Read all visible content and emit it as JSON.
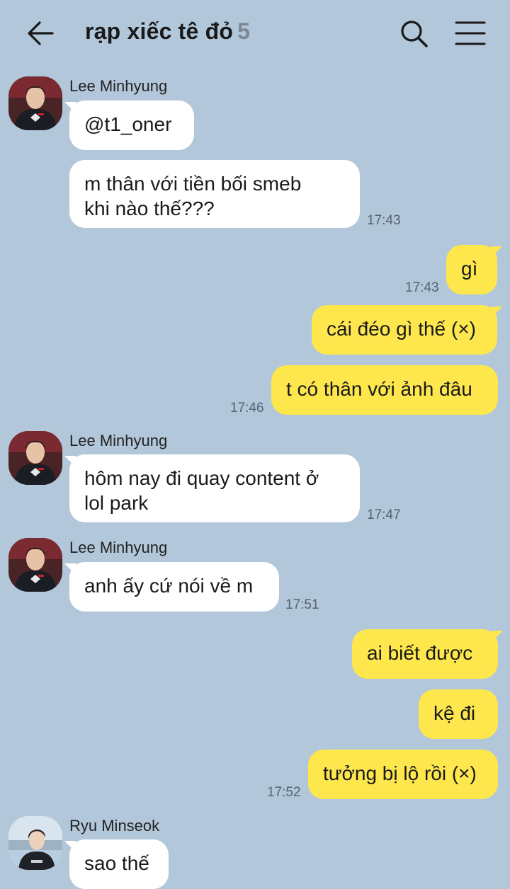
{
  "header": {
    "title": "rạp xiếc tê đỏ",
    "member_count": "5",
    "back_icon": "arrow-left-icon",
    "search_icon": "search-icon",
    "menu_icon": "hamburger-menu-icon"
  },
  "colors": {
    "background": "#b2c7da",
    "incoming_bubble": "#ffffff",
    "outgoing_bubble": "#fde74c",
    "timestamp": "#556370"
  },
  "messages": {
    "g1": {
      "sender": "Lee Minhyung",
      "m1": "@t1_oner",
      "m2": "m thân với tiền bối smeb\nkhi nào thế???",
      "time": "17:43"
    },
    "g2": {
      "m1": "gì",
      "time": "17:43"
    },
    "g3": {
      "m1": "cái đéo gì thế (×)",
      "m2": "t có thân với ảnh đâu",
      "time": "17:46"
    },
    "g4": {
      "sender": "Lee Minhyung",
      "m1": "hôm nay đi quay content ở\nlol park",
      "time": "17:47"
    },
    "g5": {
      "sender": "Lee Minhyung",
      "m1": "anh ấy cứ nói về m",
      "time": "17:51"
    },
    "g6": {
      "m1": "ai biết được",
      "m2": "kệ đi",
      "m3": "tưởng bị lộ rồi (×)",
      "time": "17:52"
    },
    "g7": {
      "sender": "Ryu Minseok",
      "m1": "sao thế"
    }
  }
}
